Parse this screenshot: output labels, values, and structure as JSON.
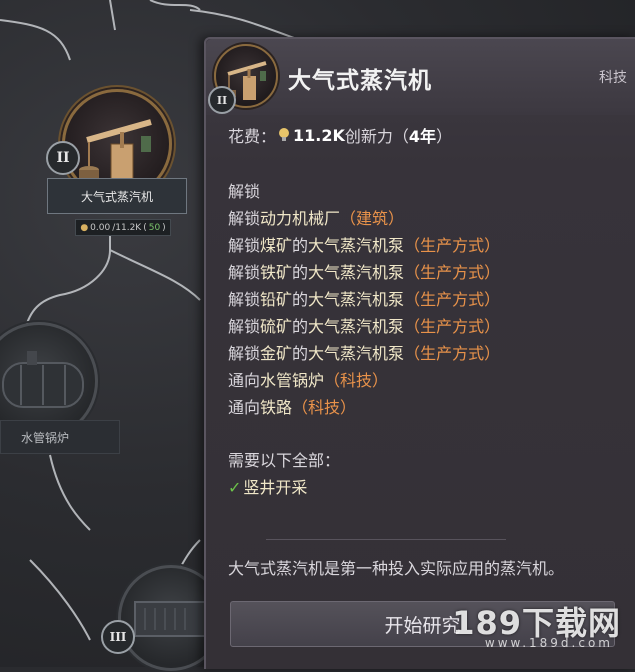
{
  "tooltip": {
    "title": "大气式蒸汽机",
    "level_roman": "II",
    "category": "科技",
    "cost": {
      "label": "花费：",
      "amount": "11.2K",
      "resource": "创新力",
      "duration_open": "（",
      "duration": "4年",
      "duration_close": "）"
    },
    "unlocks_heading": "解锁",
    "unlocks": [
      {
        "prefix": "解锁",
        "target": "动力机械厂",
        "tag": "（建筑）"
      },
      {
        "prefix": "解锁",
        "target": "煤矿",
        "mid": "的",
        "target2": "大气蒸汽机泵",
        "tag": "（生产方式）"
      },
      {
        "prefix": "解锁",
        "target": "铁矿",
        "mid": "的",
        "target2": "大气蒸汽机泵",
        "tag": "（生产方式）"
      },
      {
        "prefix": "解锁",
        "target": "铅矿",
        "mid": "的",
        "target2": "大气蒸汽机泵",
        "tag": "（生产方式）"
      },
      {
        "prefix": "解锁",
        "target": "硫矿",
        "mid": "的",
        "target2": "大气蒸汽机泵",
        "tag": "（生产方式）"
      },
      {
        "prefix": "解锁",
        "target": "金矿",
        "mid": "的",
        "target2": "大气蒸汽机泵",
        "tag": "（生产方式）"
      },
      {
        "prefix": "通向",
        "target": "水管锅炉",
        "tag": "（科技）"
      },
      {
        "prefix": "通向",
        "target": "铁路",
        "tag": "（科技）"
      }
    ],
    "requirements_heading": "需要以下全部：",
    "requirements": [
      {
        "check": "✓",
        "label": "竖井开采"
      }
    ],
    "description": "大气式蒸汽机是第一种投入实际应用的蒸汽机。",
    "start_button": "开始研究"
  },
  "tree": {
    "node_main": {
      "roman": "II",
      "label": "大气式蒸汽机",
      "progress": "0.00",
      "total": "/11.2K",
      "paren_open": "(",
      "count": "50",
      "paren_close": ")"
    },
    "node_boiler": {
      "label": "水管锅炉"
    },
    "node_rail": {
      "roman": "III"
    }
  },
  "watermark": {
    "text": "189下载网",
    "sub": "www.189d.com"
  },
  "colors": {
    "accent_orange": "#e8924a",
    "highlight": "#f0e7c8",
    "check_green": "#6cc24a",
    "medal_gold": "#8a6a3e"
  },
  "icons": {
    "tech_icon": "steam-pump-engine-icon",
    "cost_icon": "lightbulb-icon",
    "check_icon": "checkmark-icon",
    "boiler_icon": "boiler-icon",
    "rail_icon": "railcar-icon"
  }
}
